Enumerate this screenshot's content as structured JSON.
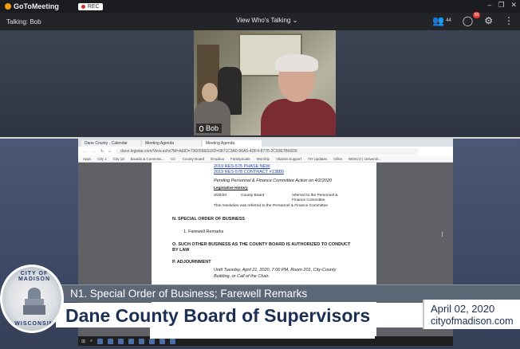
{
  "app": {
    "name": "GoToMeeting",
    "rec_label": "REC"
  },
  "toolbar": {
    "talking": "Talking: Bob",
    "view_mode": "View Who's Talking",
    "attendee_count": "44",
    "chat_count": "50"
  },
  "webcam": {
    "speaker_name": "Bob"
  },
  "browser": {
    "tabs": [
      "Dane County - Calendar",
      "Meeting Agenda",
      "Meeting Agenda"
    ],
    "url": "dane.legistar.com/View.ashx?M=A&ID=736059&GUID=0871C3A0-96A5-4DF4-8776-2C93E7B60D5",
    "bookmarks": [
      "Apps",
      "City 1",
      "City 19",
      "Boards & Commiss...",
      "CC",
      "County Board",
      "Dropbox",
      "FamilyScale",
      "Worship",
      "Vitamin Support",
      "YH Updates",
      "Inline",
      "NESCO | Universit..."
    ]
  },
  "document": {
    "links": [
      "2019 RES-575 PHASE NEW",
      "2019 RES-578 CONTRACT #13880"
    ],
    "pending": "Pending Personnel & Finance Committee Action on 4/2/2020",
    "legislative_history": "Legislative History",
    "history_date": "3/20/20",
    "history_body": "County Board",
    "history_action": "referred to the Personnel &",
    "history_action2": "Finance Committee",
    "history_note": "This resolution was referred to the Personnel & Finance Committee",
    "section_n": "N. SPECIAL ORDER OF BUSINESS",
    "item_n1": "1.   Farewell Remarks",
    "section_o": "O. SUCH OTHER BUSINESS AS THE COUNTY BOARD IS AUTHORIZED TO CONDUCT",
    "section_o2": "BY LAW",
    "section_p": "P. ADJOURNMENT",
    "adjourn1": "Until Tuesday, April 21, 2020, 7:00 PM, Room 201, City-County",
    "adjourn2": "Building, or Call of the Chair."
  },
  "lower_third": {
    "seal_top": "CITY OF MADISON",
    "seal_bottom": "WISCONSIN",
    "subtitle": "N1. Special Order of Business; Farewell Remarks",
    "title": "Dane County Board of Supervisors",
    "date": "April 02, 2020",
    "site": "cityofmadison.com"
  }
}
